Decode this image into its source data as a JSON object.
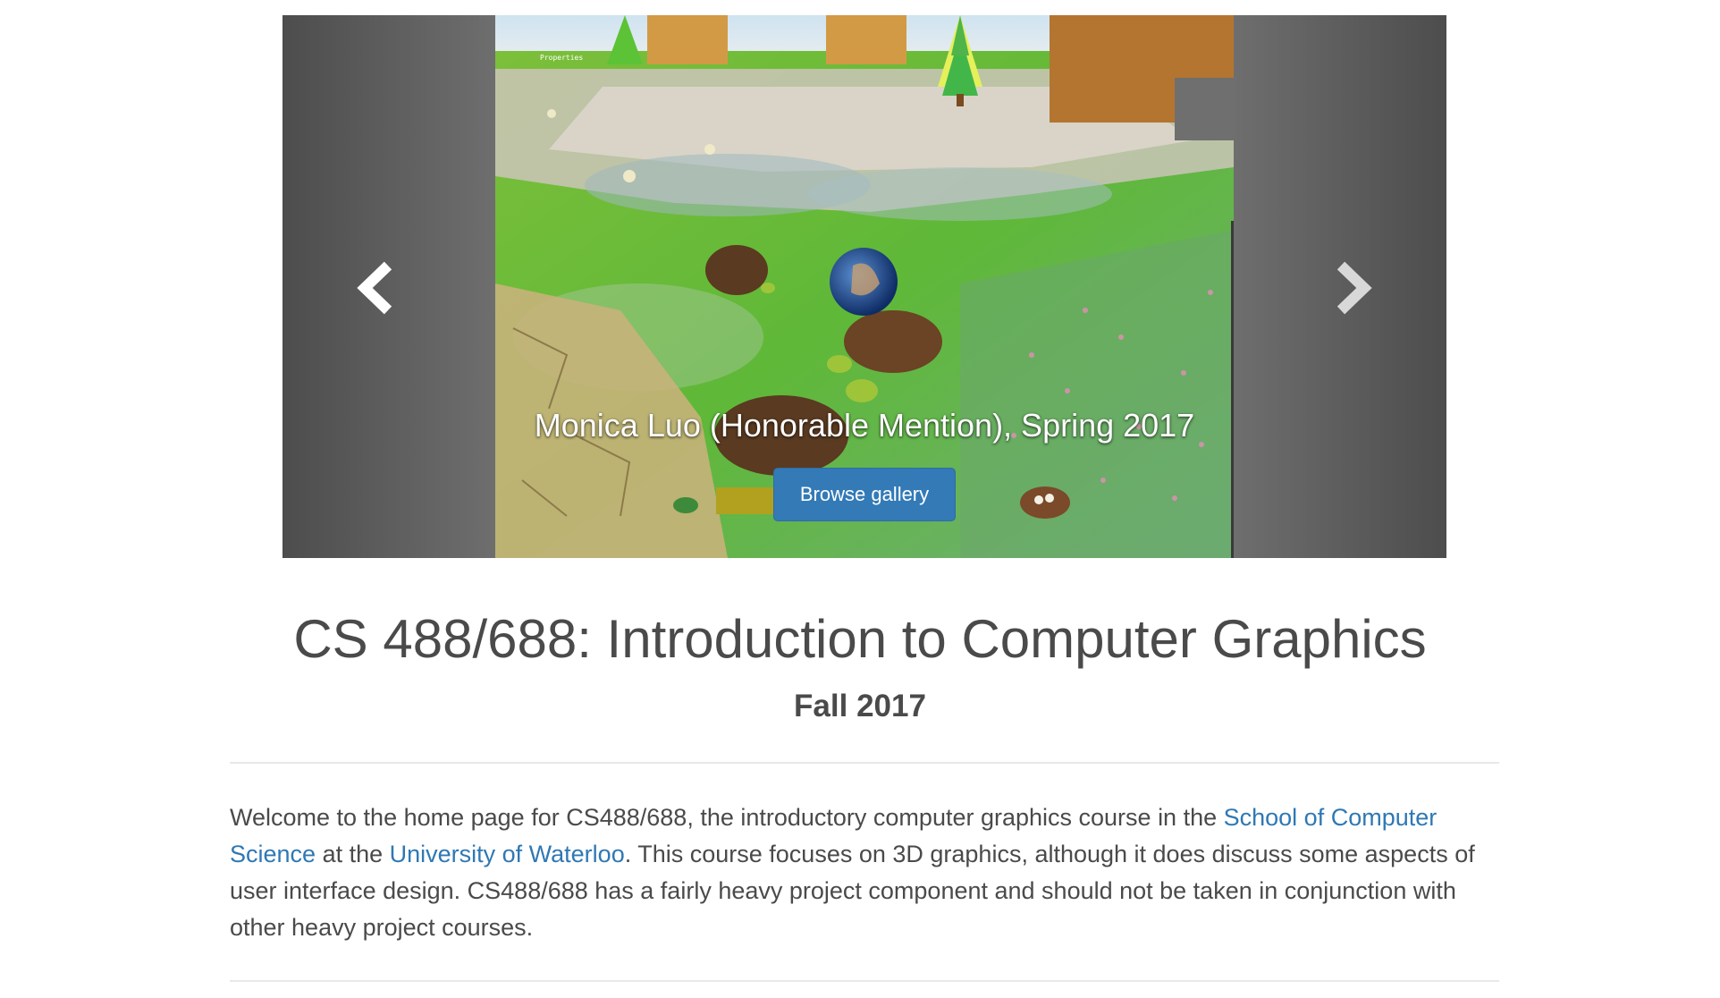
{
  "carousel": {
    "caption": "Monica Luo (Honorable Mention), Spring 2017",
    "button_label": "Browse gallery",
    "prev_icon": "chevron-left-icon",
    "next_icon": "chevron-right-icon",
    "overlay_label": "Properties"
  },
  "header": {
    "title": "CS 488/688: Introduction to Computer Graphics",
    "subtitle": "Fall 2017"
  },
  "intro": {
    "text_1": "Welcome to the home page for CS488/688, the introductory computer graphics course in the ",
    "link_1": "School of Computer Science",
    "text_2": " at the ",
    "link_2": "University of Waterloo",
    "text_3": ". This course focuses on 3D graphics, although it does discuss some aspects of user interface design. CS488/688 has a fairly heavy project component and should not be taken in conjunction with other heavy project courses."
  },
  "colors": {
    "button": "#337ab7",
    "link": "#2f78b4",
    "text": "#4a4a4a"
  }
}
